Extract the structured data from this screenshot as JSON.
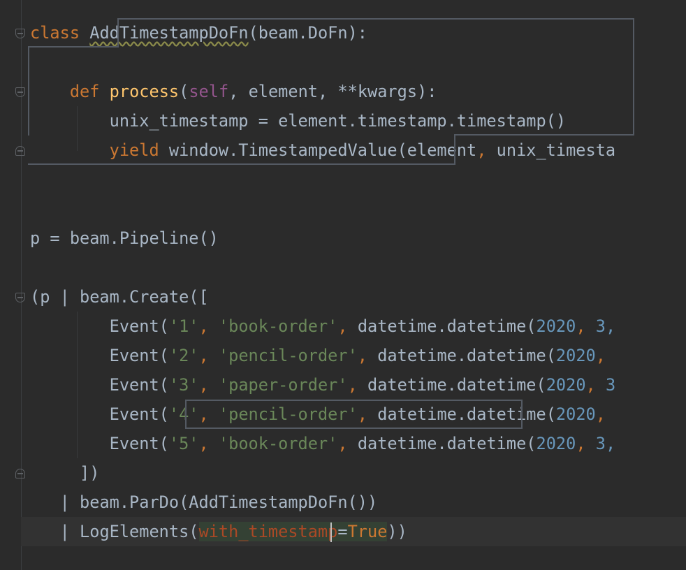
{
  "editor": {
    "lines": {
      "l1": {
        "kw": "class",
        "name": "AddTimestampDoFn",
        "rest": "(beam.DoFn):"
      },
      "l3": {
        "kw": "def",
        "fn": "process",
        "p1": "(",
        "self": "self",
        "rest": ", element, **kwargs):"
      },
      "l4": {
        "text": "unix_timestamp = element.timestamp.timestamp()"
      },
      "l5": {
        "kw": "yield",
        "rest1": " window.TimestampedValue(element",
        "comma": ",",
        "rest2": " unix_timesta"
      },
      "l8": {
        "text": "p = beam.Pipeline()"
      },
      "l10": {
        "pre": "(p | beam.Create(["
      },
      "events": [
        {
          "a": "Event(",
          "s1": "'1'",
          "c1": ", ",
          "s2": "'book-order'",
          "c2": ", ",
          "b": "datetime.datetime(",
          "n1": "2020",
          "c3": ", ",
          "n2": "3,"
        },
        {
          "a": "Event(",
          "s1": "'2'",
          "c1": ", ",
          "s2": "'pencil-order'",
          "c2": ", ",
          "b": "datetime.datetime(",
          "n1": "2020",
          "c3": ",",
          "n2": ""
        },
        {
          "a": "Event(",
          "s1": "'3'",
          "c1": ", ",
          "s2": "'paper-order'",
          "c2": ", ",
          "b": "datetime.datetime(",
          "n1": "2020",
          "c3": ", ",
          "n2": "3"
        },
        {
          "a": "Event(",
          "s1": "'4'",
          "c1": ", ",
          "s2": "'pencil-order'",
          "c2": ", ",
          "b": "datetime.datetime(",
          "n1": "2020",
          "c3": ",",
          "n2": ""
        },
        {
          "a": "Event(",
          "s1": "'5'",
          "c1": ", ",
          "s2": "'book-order'",
          "c2": ", ",
          "b": "datetime.datetime(",
          "n1": "2020",
          "c3": ", ",
          "n2": "3,"
        }
      ],
      "l16": {
        "text": "])"
      },
      "l17": {
        "text": "| beam.ParDo(AddTimestampDoFn())"
      },
      "l18": {
        "pre": "| LogElements(",
        "param": "with_timestamp",
        "eq": "=",
        "kwv": "True",
        "post": "))"
      }
    }
  },
  "colors": {
    "background": "#2b2b2b",
    "keyword": "#cc7832",
    "function": "#ffc66d",
    "string": "#6a8759",
    "number": "#6897bb",
    "self": "#94558d",
    "param": "#aa4926",
    "default": "#a9b7c6"
  }
}
